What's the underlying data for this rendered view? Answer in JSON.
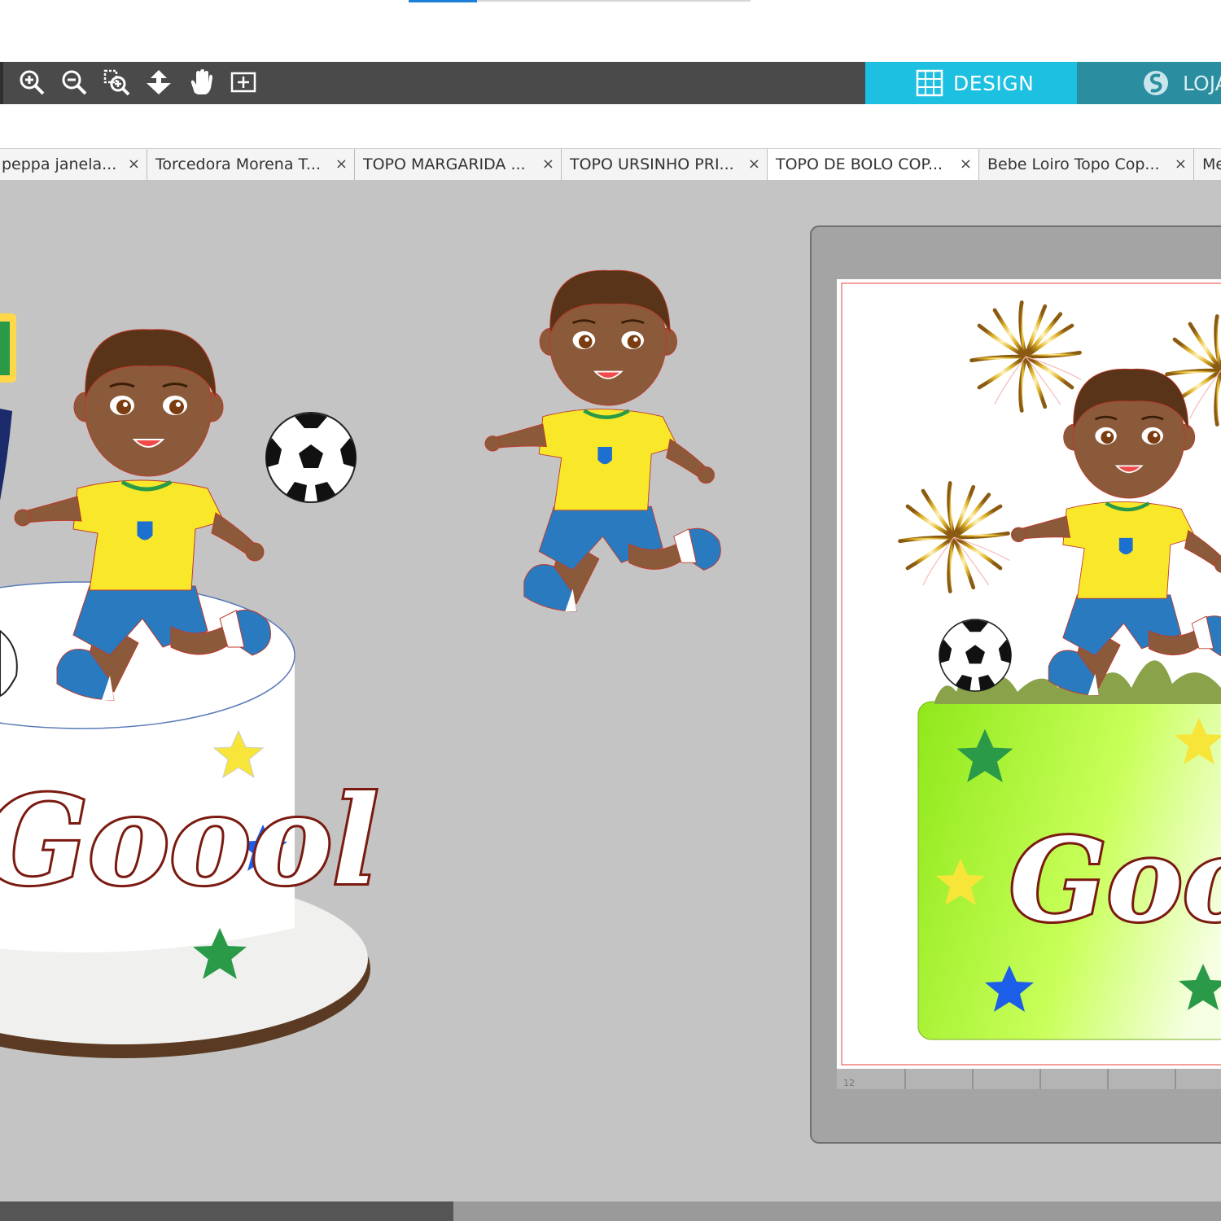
{
  "toolbar": {
    "tools": [
      {
        "name": "zoom-in",
        "icon": "zoom-in-icon"
      },
      {
        "name": "zoom-out",
        "icon": "zoom-out-icon"
      },
      {
        "name": "zoom-selection",
        "icon": "zoom-selection-icon"
      },
      {
        "name": "move-down",
        "icon": "arrow-down-icon"
      },
      {
        "name": "pan",
        "icon": "hand-icon"
      },
      {
        "name": "fit-to-page",
        "icon": "fit-page-icon"
      }
    ],
    "design_label": "DESIGN",
    "store_label": "LOJA",
    "accent_color": "#1ec0e2"
  },
  "tabs": [
    {
      "label": "peppa janela..."
    },
    {
      "label": "Torcedora Morena T..."
    },
    {
      "label": "TOPO MARGARIDA ..."
    },
    {
      "label": "TOPO URSINHO PRI..."
    },
    {
      "label": "TOPO DE BOLO COP...",
      "active": true
    },
    {
      "label": "Bebe Loiro Topo Cop..."
    },
    {
      "label": "Me"
    }
  ],
  "tab_close_glyph": "×",
  "canvas": {
    "cake_text": "Goool",
    "page_text": "Goool",
    "page_ruler_number": "12"
  }
}
